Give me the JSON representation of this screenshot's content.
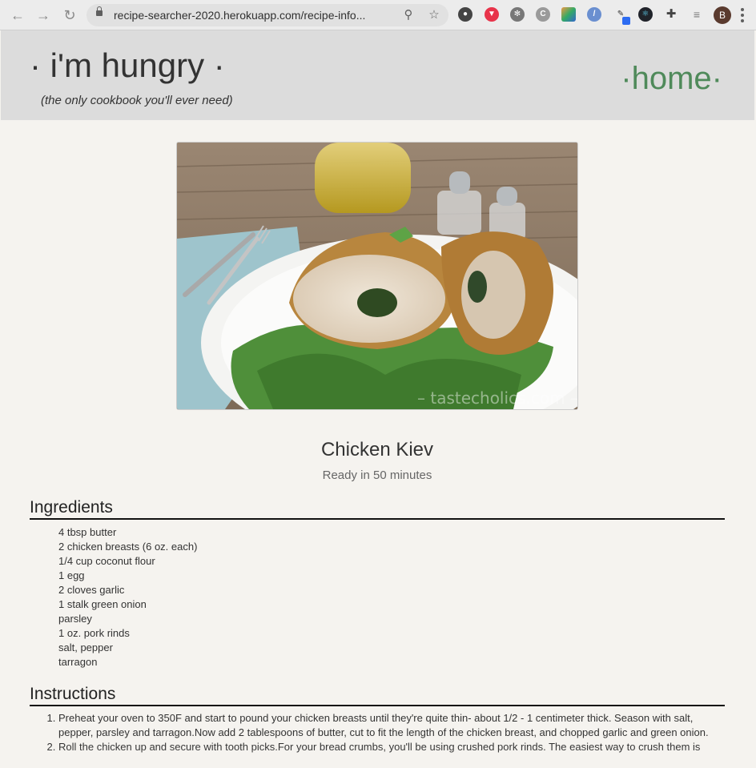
{
  "browser": {
    "url": "recipe-searcher-2020.herokuapp.com/recipe-info...",
    "avatar_letter": "B"
  },
  "header": {
    "title": "· i'm hungry ·",
    "tagline": "(the only cookbook you'll ever need)",
    "home_link": "·home·",
    "home_color": "#4f8a5a"
  },
  "recipe": {
    "title": "Chicken Kiev",
    "ready": "Ready in 50 minutes",
    "image_watermark": "– tastecholics.com –",
    "ingredients_heading": "Ingredients",
    "ingredients": [
      "4 tbsp butter",
      "2 chicken breasts (6 oz. each)",
      "1/4 cup coconut flour",
      "1 egg",
      "2 cloves garlic",
      "1 stalk green onion",
      "parsley",
      "1 oz. pork rinds",
      "salt, pepper",
      "tarragon"
    ],
    "instructions_heading": "Instructions",
    "instructions": [
      "Preheat your oven to 350F and start to pound your chicken breasts until they're quite thin- about 1/2 - 1 centimeter thick. Season with salt, pepper, parsley and tarragon.Now add 2 tablespoons of butter, cut to fit the length of the chicken breast, and chopped garlic and green onion.",
      "Roll the chicken up and secure with tooth picks.For your bread crumbs, you'll be using crushed pork rinds. The easiest way to crush them is"
    ]
  }
}
